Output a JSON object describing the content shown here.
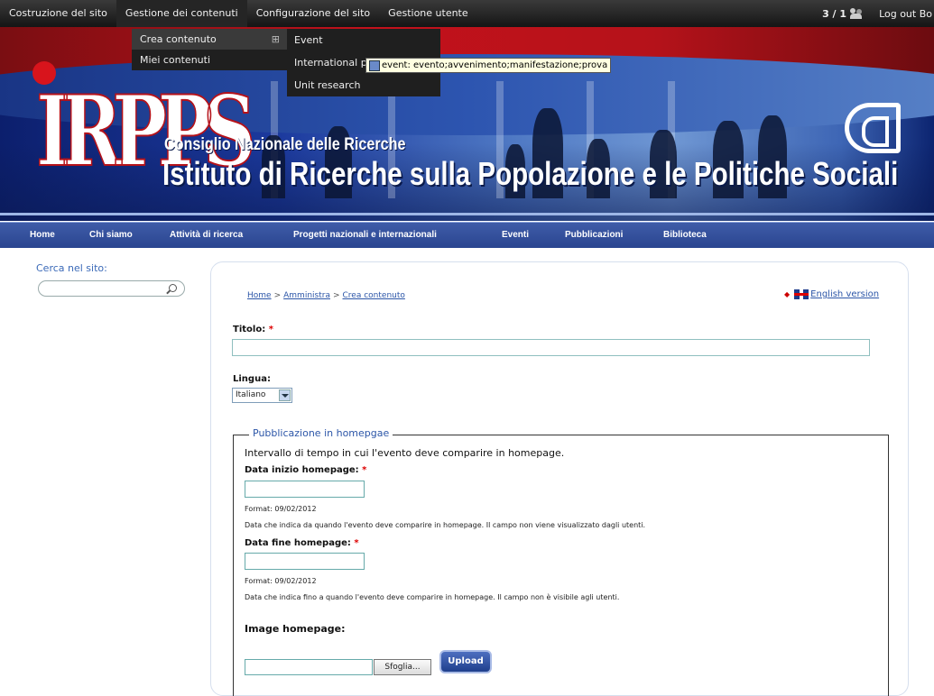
{
  "admin_bar": {
    "menu": [
      "Costruzione del sito",
      "Gestione dei contenuti",
      "Configurazione del sito",
      "Gestione utente"
    ],
    "counter": "3 / 1",
    "logout": "Log out Bo"
  },
  "dropdown": {
    "items": [
      "Crea contenuto",
      "Miei contenuti"
    ],
    "submenu": [
      "Event",
      "International p",
      "Unit research"
    ]
  },
  "tooltip": "event: evento;avvenimento;manifestazione;prova",
  "banner": {
    "logo_text": "IRPPS",
    "subtitle": "Consiglio Nazionale delle Ricerche",
    "title": "Istituto di Ricerche sulla Popolazione e le Politiche Sociali"
  },
  "nav": [
    "Home",
    "Chi siamo",
    "Attività di ricerca",
    "Progetti nazionali e internazionali",
    "Eventi",
    "Pubblicazioni",
    "Biblioteca"
  ],
  "search": {
    "label": "Cerca nel sito:"
  },
  "breadcrumb": [
    "Home",
    "Amministra",
    "Crea contenuto"
  ],
  "breadcrumb_sep": ">",
  "english_link": "English version",
  "form": {
    "title_label": "Titolo:",
    "required_mark": "*",
    "language_label": "Lingua:",
    "language_value": "Italiano",
    "fieldset_legend": "Pubblicazione in homepgae",
    "intro": "Intervallo di tempo in cui l'evento deve comparire in homepage.",
    "start_label": "Data inizio homepage:",
    "start_format": "Format: 09/02/2012",
    "start_help": "Data che indica da quando l'evento deve comparire in homepage. Il campo non viene visualizzato dagli utenti.",
    "end_label": "Data fine homepage:",
    "end_format": "Format: 09/02/2012",
    "end_help": "Data che indica fino a quando l'evento deve comparire in homepage. Il campo non è visibile agli utenti.",
    "image_label": "Image homepage:",
    "browse_label": "Sfoglia...",
    "upload_label": "Upload"
  }
}
